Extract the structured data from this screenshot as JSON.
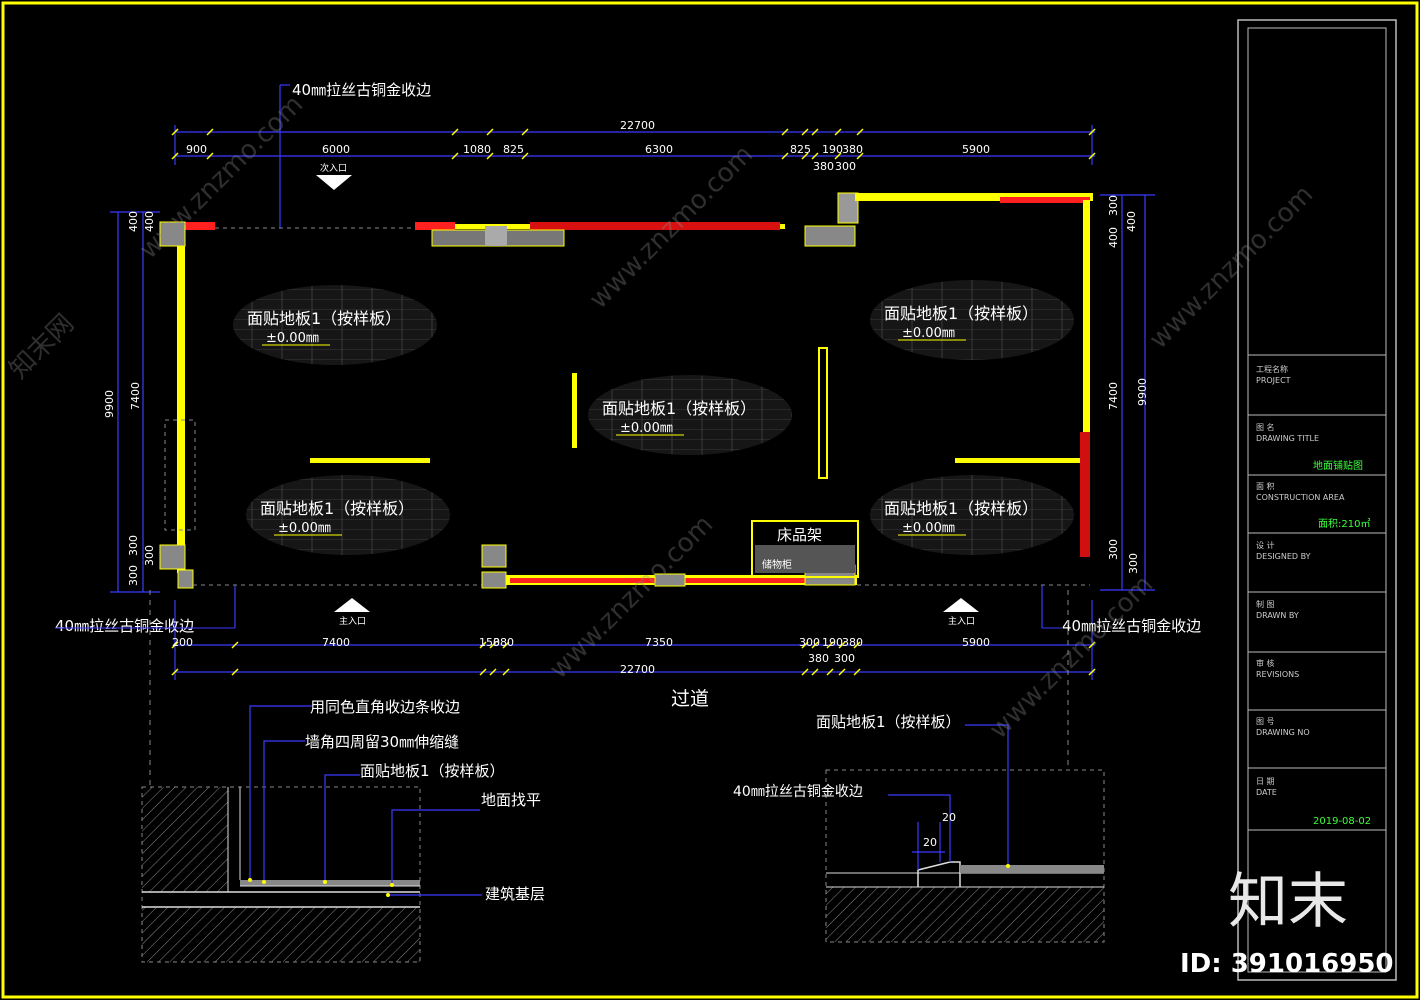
{
  "labels": {
    "edge_trim": "40㎜拉丝古铜金收边",
    "floor_label": "面贴地板1（按样板）",
    "floor_level": "±0.00㎜",
    "secondary_entrance": "次入口",
    "main_entrance": "主入口",
    "corridor": "过道",
    "bed_rack": "床品架",
    "storage_cabinet": "储物柜"
  },
  "dims": {
    "top_total": "22700",
    "top": [
      "900",
      "6000",
      "1080",
      "825",
      "6300",
      "825",
      "190",
      "380",
      "380",
      "300",
      "5900"
    ],
    "bottom_total": "22700",
    "bottom": [
      "200",
      "7400",
      "150",
      "380",
      "7350",
      "300",
      "190",
      "380",
      "380",
      "300",
      "5900"
    ],
    "left": [
      "400",
      "400",
      "9900",
      "7400",
      "300",
      "300",
      "300"
    ],
    "right": [
      "300",
      "400",
      "400",
      "7400",
      "9900",
      "300",
      "300"
    ]
  },
  "detail_left": {
    "notes": [
      "用同色直角收边条收边",
      "墙角四周留30㎜伸缩缝",
      "面贴地板1（按样板）",
      "地面找平",
      "建筑基层"
    ]
  },
  "detail_right": {
    "notes": [
      "面贴地板1（按样板）",
      "40㎜拉丝古铜金收边"
    ],
    "dim_a": "20",
    "dim_b": "20"
  },
  "title_block": {
    "project_cn": "工程名称",
    "project_en": "PROJECT",
    "drawing_title_cn": "图 名",
    "drawing_title_en": "DRAWING TITLE",
    "drawing_title_val": "地面铺贴图",
    "area_cn": "面 积",
    "area_en": "CONSTRUCTION AREA",
    "area_val": "面积:210㎡",
    "designer_cn": "设 计",
    "designer_en": "DESIGNED BY",
    "drawn_cn": "制 图",
    "drawn_en": "DRAWN BY",
    "review_cn": "审 核",
    "review_en": "REVISIONS",
    "no_cn": "图 号",
    "no_en": "DRAWING NO",
    "date_cn": "日 期",
    "date_en": "DATE",
    "date_val": "2019-08-02"
  },
  "watermark": {
    "logo": "知末",
    "id": "ID: 391016950",
    "site": "www.znzmo.com",
    "site_cn": "知末网"
  },
  "colors": {
    "frame": "#ffff00",
    "wall": "#ffff00",
    "dim": "#3a3aff",
    "hatch_red": "#ff2020",
    "text": "#ffffff"
  }
}
